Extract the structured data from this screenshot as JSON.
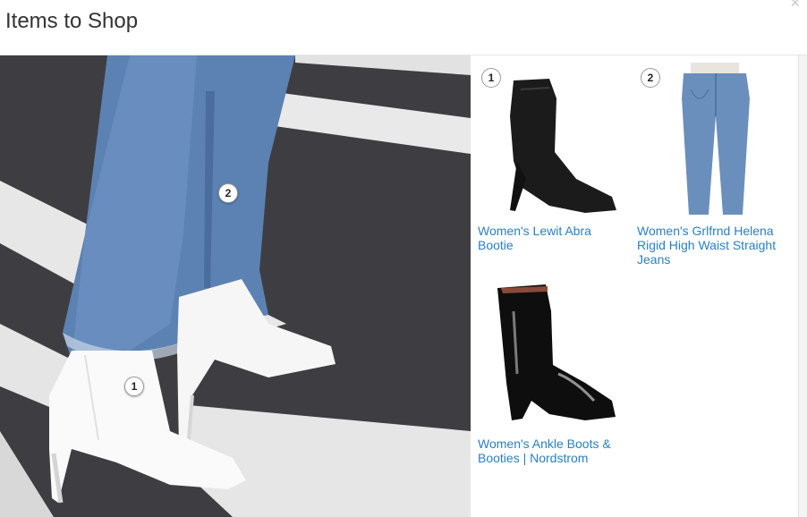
{
  "header": {
    "title": "Items to Shop",
    "close_glyph": "×"
  },
  "hero": {
    "description_markers": [
      {
        "number": "1"
      },
      {
        "number": "2"
      }
    ]
  },
  "products": [
    {
      "number": "1",
      "name": "Women's Lewit Abra Bootie",
      "icon": "black-ankle-bootie"
    },
    {
      "number": "2",
      "name": "Women's Grlfrnd Helena Rigid High Waist Straight Jeans",
      "icon": "straight-jeans"
    },
    {
      "number": "",
      "name": "Women's Ankle Boots & Booties | Nordstrom",
      "icon": "patent-ankle-boot"
    }
  ]
}
